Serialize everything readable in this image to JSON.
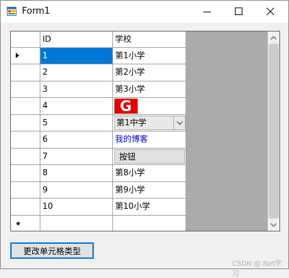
{
  "window": {
    "title": "Form1",
    "icon": "form-window-icon",
    "controls": [
      "minimize-icon",
      "maximize-icon",
      "close-icon"
    ]
  },
  "grid": {
    "columns": [
      "ID",
      "学校"
    ],
    "rows": [
      {
        "id": "1",
        "school": "第1小学",
        "type": "text",
        "current": true
      },
      {
        "id": "2",
        "school": "第2小学",
        "type": "text"
      },
      {
        "id": "3",
        "school": "第3小学",
        "type": "text"
      },
      {
        "id": "4",
        "school": "",
        "type": "image",
        "image_letter": "G"
      },
      {
        "id": "5",
        "school": "第1中学",
        "type": "combobox"
      },
      {
        "id": "6",
        "school": "我的博客",
        "type": "link"
      },
      {
        "id": "7",
        "school": "按钮",
        "type": "button"
      },
      {
        "id": "8",
        "school": "第8小学",
        "type": "text"
      },
      {
        "id": "9",
        "school": "第9小学",
        "type": "text"
      },
      {
        "id": "10",
        "school": "第10小学",
        "type": "text"
      }
    ],
    "colors": {
      "selection": "#0078d7",
      "link": "#0000cc",
      "image": "#e00000",
      "empty_area": "#ababab"
    }
  },
  "action_button": {
    "label": "更改单元格类型"
  },
  "watermark": {
    "text": "CSDN @.Net学习"
  }
}
